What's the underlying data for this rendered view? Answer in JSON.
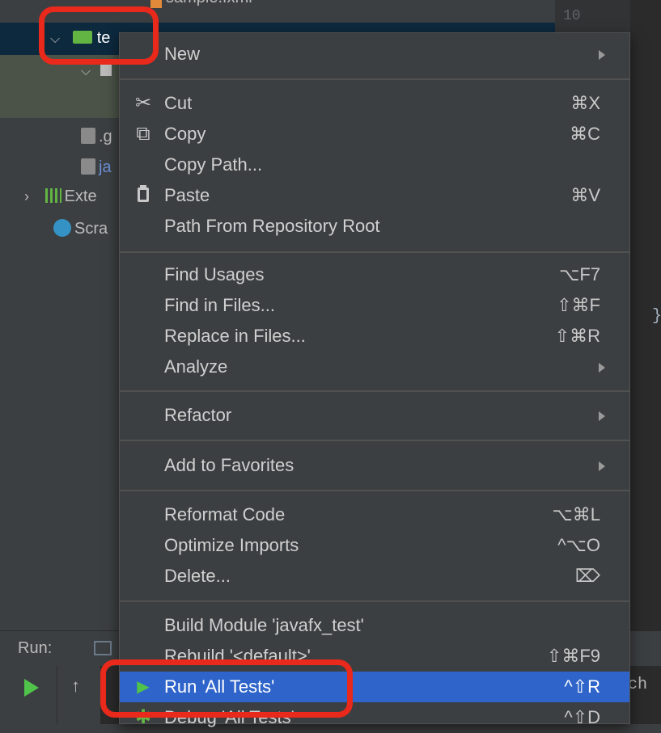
{
  "project_tree": {
    "partial_file_name": "sample.fxml",
    "test_folder_label": "te",
    "gitignore_prefix": ".g",
    "iml_prefix": "ja",
    "external_libraries_prefix": "Exte",
    "scratches_prefix": "Scra"
  },
  "editor": {
    "line_number": "10",
    "closing_brace": "}",
    "console_partial": "ch"
  },
  "run_panel": {
    "label": "Run:"
  },
  "context_menu": {
    "items": [
      {
        "label": "New",
        "shortcut": "",
        "submenu": true
      },
      {
        "label": "Cut",
        "shortcut": "⌘X",
        "icon": "scissors-icon",
        "glyph": "✂"
      },
      {
        "label": "Copy",
        "shortcut": "⌘C",
        "icon": "copy-icon",
        "glyph": "⧉"
      },
      {
        "label": "Copy Path...",
        "shortcut": ""
      },
      {
        "label": "Paste",
        "shortcut": "⌘V",
        "icon": "clipboard-icon",
        "glyph": "📋"
      },
      {
        "label": "Path From Repository Root",
        "shortcut": ""
      },
      {
        "label": "Find Usages",
        "shortcut": "⌥F7"
      },
      {
        "label": "Find in Files...",
        "shortcut": "⇧⌘F"
      },
      {
        "label": "Replace in Files...",
        "shortcut": "⇧⌘R"
      },
      {
        "label": "Analyze",
        "shortcut": "",
        "submenu": true
      },
      {
        "label": "Refactor",
        "shortcut": "",
        "submenu": true
      },
      {
        "label": "Add to Favorites",
        "shortcut": "",
        "submenu": true
      },
      {
        "label": "Reformat Code",
        "shortcut": "⌥⌘L"
      },
      {
        "label": "Optimize Imports",
        "shortcut": "^⌥O"
      },
      {
        "label": "Delete...",
        "shortcut": "⌦"
      },
      {
        "label": "Build Module 'javafx_test'",
        "shortcut": ""
      },
      {
        "label": "Rebuild '<default>'",
        "shortcut": "⇧⌘F9"
      },
      {
        "label": "Run 'All Tests'",
        "shortcut": "^⇧R",
        "icon": "run-icon",
        "glyph": "▶"
      },
      {
        "label": "Debug 'All Tests'",
        "shortcut": "^⇧D",
        "icon": "debug-icon",
        "glyph": "✱"
      }
    ]
  },
  "colors": {
    "menu_background": "#3c3f41",
    "selection": "#2f65ca",
    "callout": "#e8291b",
    "run_green": "#4fc34a"
  }
}
